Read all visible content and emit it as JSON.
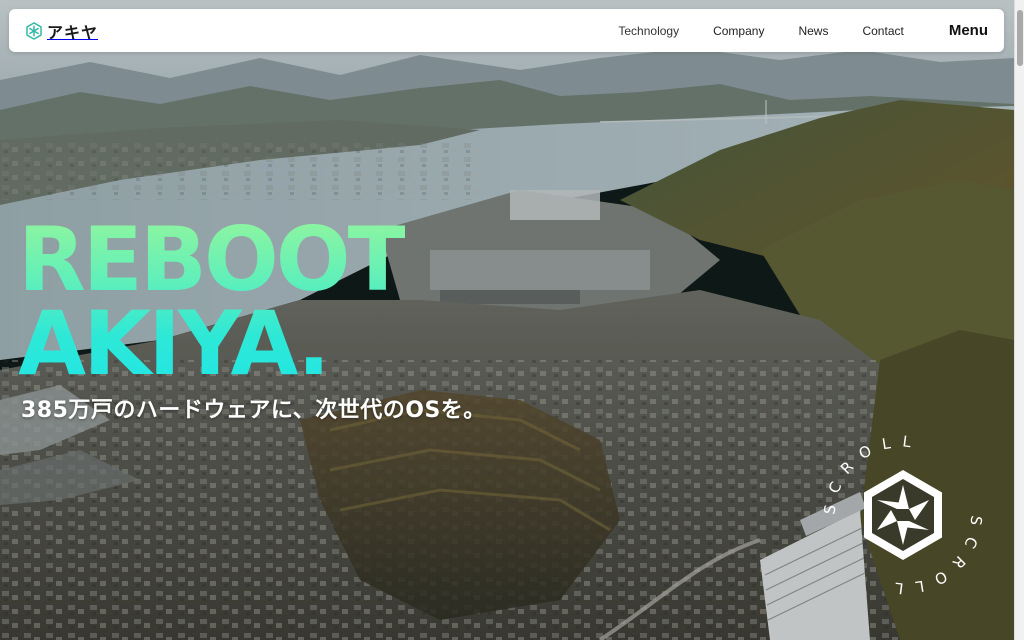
{
  "header": {
    "brand_name": "アキヤ",
    "nav": [
      {
        "label": "Technology"
      },
      {
        "label": "Company"
      },
      {
        "label": "News"
      },
      {
        "label": "Contact"
      }
    ],
    "menu_label": "Menu"
  },
  "hero": {
    "title_line1": "REBOOT",
    "title_line2": "AKIYA.",
    "subtitle": "385万戸のハードウェアに、次世代のOSを。"
  },
  "scroll_indicator": {
    "label": "SCROLL"
  },
  "colors": {
    "accent_green": "#8ff59f",
    "accent_cyan": "#22e6e4",
    "header_bg": "#ffffff",
    "brand_mark": "#2fb7a3"
  },
  "icons": {
    "brand": "snowflake-logo-icon",
    "scroll": "snowflake-scroll-icon"
  }
}
